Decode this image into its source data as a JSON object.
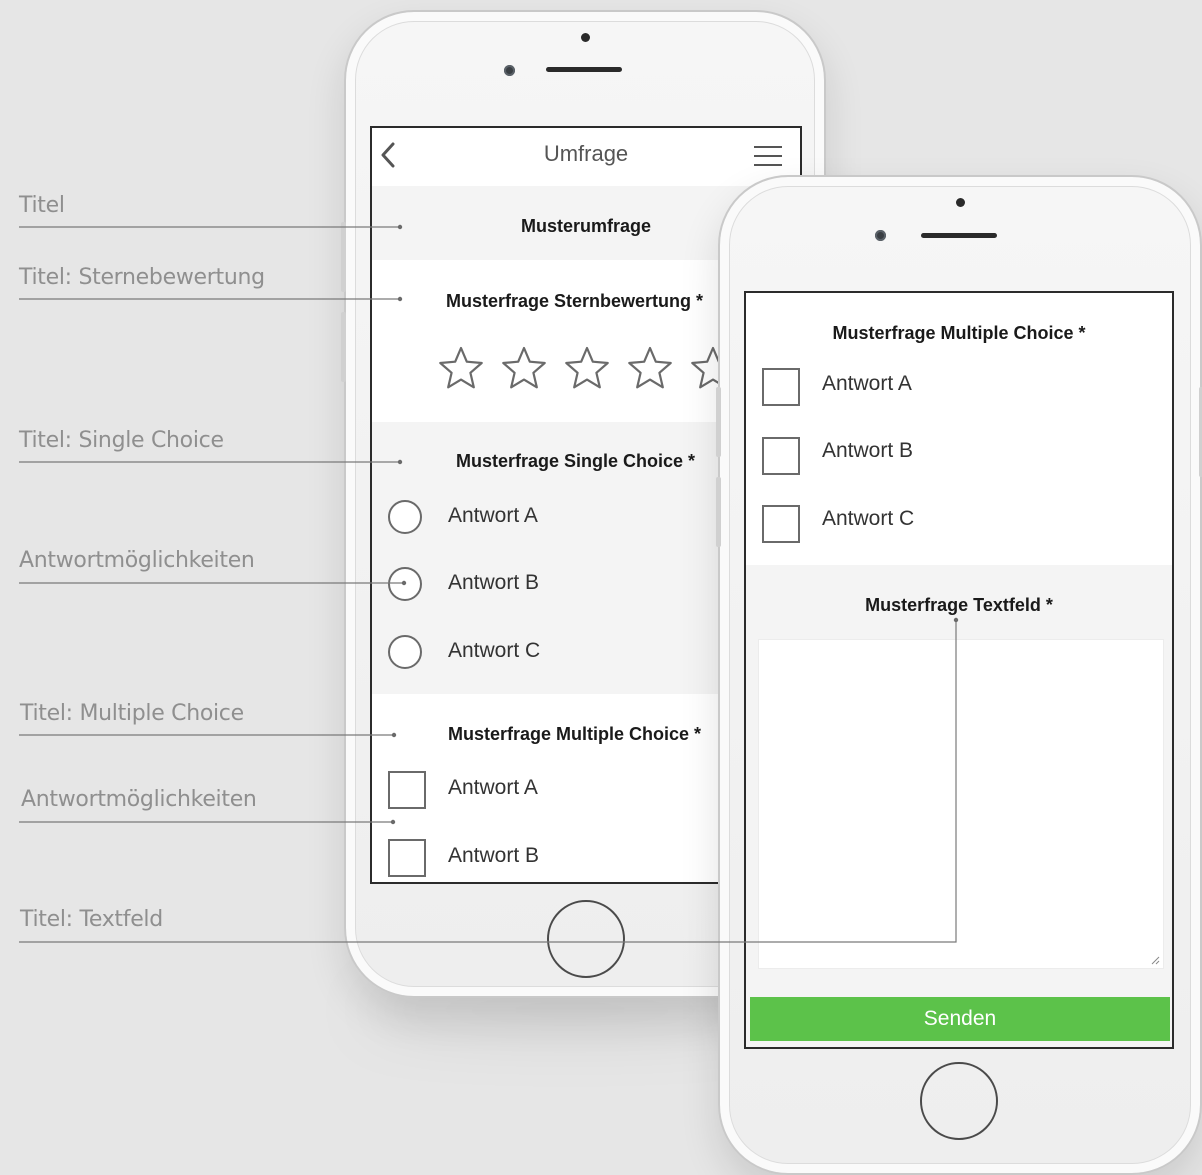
{
  "annotations": [
    {
      "label": "Titel"
    },
    {
      "label": "Titel: Sternebewertung"
    },
    {
      "label": "Titel: Single Choice"
    },
    {
      "label": "Antwortmöglichkeiten"
    },
    {
      "label": "Titel: Multiple Choice"
    },
    {
      "label": "Antwortmöglichkeiten"
    },
    {
      "label": "Titel: Textfeld"
    }
  ],
  "phone_left": {
    "nav": {
      "title": "Umfrage"
    },
    "survey_title": "Musterumfrage",
    "star_question": {
      "title": "Musterfrage Sternbewertung *",
      "stars_selected": 0,
      "stars_total": 5
    },
    "single_choice": {
      "title": "Musterfrage Single Choice *",
      "options": [
        "Antwort A",
        "Antwort B",
        "Antwort C"
      ]
    },
    "multiple_choice": {
      "title": "Musterfrage Multiple Choice *",
      "options": [
        "Antwort A",
        "Antwort B"
      ]
    }
  },
  "phone_right": {
    "multiple_choice": {
      "title": "Musterfrage Multiple Choice *",
      "options": [
        "Antwort A",
        "Antwort B",
        "Antwort C"
      ]
    },
    "textfield": {
      "title": "Musterfrage Textfeld *",
      "value": ""
    },
    "submit_label": "Senden"
  },
  "colors": {
    "background": "#e6e6e6",
    "submit_button": "#5cc24a",
    "annotation_text": "#8f8f8f"
  }
}
